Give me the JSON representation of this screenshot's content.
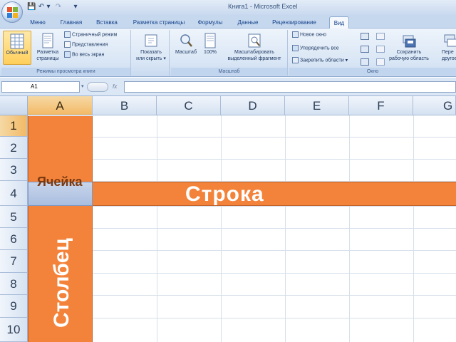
{
  "window": {
    "title": "Книга1 - Microsoft Excel"
  },
  "quick_access": {
    "save_glyph": "💾",
    "undo_glyph": "↶",
    "redo_glyph": "↷",
    "more_glyph": "▾"
  },
  "tabs": [
    {
      "label": "Меню",
      "active": false
    },
    {
      "label": "Главная",
      "active": false
    },
    {
      "label": "Вставка",
      "active": false
    },
    {
      "label": "Разметка страницы",
      "active": false
    },
    {
      "label": "Формулы",
      "active": false
    },
    {
      "label": "Данные",
      "active": false
    },
    {
      "label": "Рецензирование",
      "active": false
    },
    {
      "label": "Вид",
      "active": true
    }
  ],
  "ribbon": {
    "groups": {
      "views": {
        "label": "Режимы просмотра книги",
        "normal": "Обычный",
        "page_layout_1": "Разметка",
        "page_layout_2": "страницы",
        "page_break": "Страничный режим",
        "custom_views": "Представления",
        "full_screen": "Во весь экран"
      },
      "show": {
        "line1": "Показать",
        "line2": "или скрыть",
        "arrow": "▾"
      },
      "zoom": {
        "label": "Масштаб",
        "zoom": "Масштаб",
        "hundred": "100%",
        "fit_1": "Масштабировать",
        "fit_2": "выделенный фрагмент"
      },
      "window": {
        "label": "Окно",
        "new_window": "Новое окно",
        "arrange_all": "Упорядочить все",
        "freeze": "Закрепить области",
        "freeze_arrow": "▾",
        "save_ws_1": "Сохранить",
        "save_ws_2": "рабочую область",
        "switch_1": "Пере",
        "switch_2": "другое"
      }
    }
  },
  "formula_bar": {
    "name_box": "A1",
    "fx": "fx",
    "value": ""
  },
  "sheet": {
    "columns": [
      "A",
      "B",
      "C",
      "D",
      "E",
      "F",
      "G"
    ],
    "rows": [
      "1",
      "2",
      "3",
      "4",
      "5",
      "6",
      "7",
      "8",
      "9",
      "10"
    ]
  },
  "annotations": {
    "row": "Строка",
    "cell": "Ячейка",
    "column": "Столбец"
  },
  "colors": {
    "accent_orange": "#f3833a",
    "ribbon_blue": "#d9e6f5",
    "header_blue": "#d5e2f2"
  }
}
